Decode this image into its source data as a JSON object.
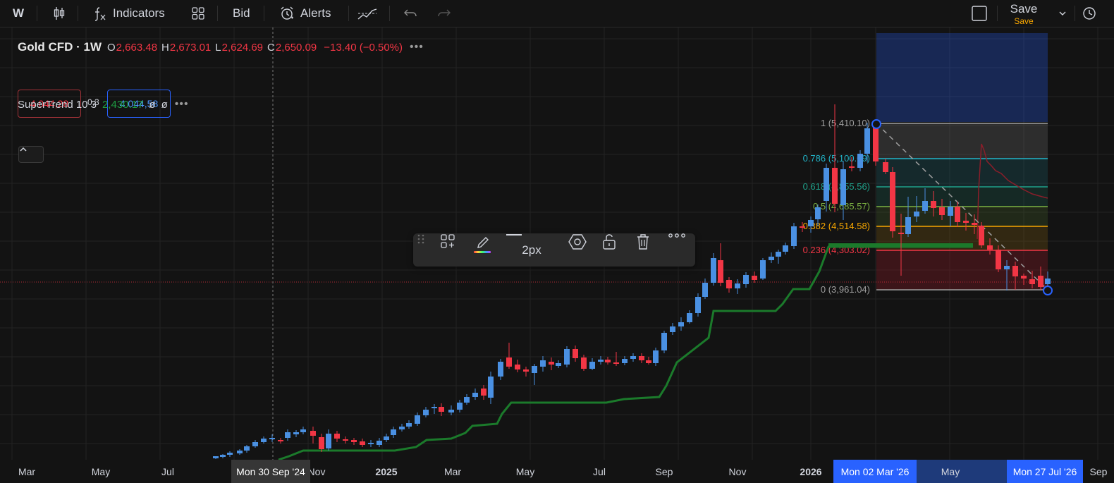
{
  "toolbar": {
    "symbol_short": "W",
    "indicators_label": "Indicators",
    "bid_label": "Bid",
    "alerts_label": "Alerts",
    "save_label": "Save",
    "save_sublabel": "Save",
    "icons": [
      "candles-icon",
      "fx-icon",
      "layout-grid-icon",
      "alert-clock-icon",
      "replay-icon",
      "undo-icon",
      "redo-icon",
      "square-icon",
      "chevron-down-icon",
      "clock-icon"
    ]
  },
  "legend": {
    "symbol": "Gold CFD · 1W",
    "o_key": "O",
    "o_val": "2,663.48",
    "h_key": "H",
    "h_val": "2,673.01",
    "l_key": "L",
    "l_val": "2,624.69",
    "c_key": "C",
    "c_val": "2,650.09",
    "change": "−13.40 (−0.50%)",
    "more": "•••",
    "bid_price": "4 044,28",
    "spread": "0,3",
    "ask_price": "4 044,58",
    "supertrend_name": "SuperTrend 10 3",
    "supertrend_value": "2,430.17",
    "supertrend_na1": "ø",
    "supertrend_na2": "ø",
    "supertrend_more": "•••"
  },
  "drawing_toolbar": {
    "width_label": "2px",
    "icons": [
      "drag-handle-icon",
      "add-to-template-icon",
      "pencil-color-icon",
      "line-style-icon",
      "settings-hexagon-icon",
      "unlock-icon",
      "trash-icon",
      "more-icon"
    ]
  },
  "fib_levels": [
    {
      "label": "1 (5,410.10)",
      "color": "#9e9e9e"
    },
    {
      "label": "0.786 (5,100.09)",
      "color": "#22b4c8"
    },
    {
      "label": "0.618 (4,855.56)",
      "color": "#1fa08a"
    },
    {
      "label": "0.5 (4,685.57)",
      "color": "#7cb342"
    },
    {
      "label": "0.382 (4,514.58)",
      "color": "#f7a600"
    },
    {
      "label": "0.236 (4,303.02)",
      "color": "#f23645"
    },
    {
      "label": "0 (3,961.04)",
      "color": "#9e9e9e"
    }
  ],
  "time_axis": {
    "ticks": [
      "Mar",
      "May",
      "Jul",
      "Nov",
      "2025",
      "Mar",
      "May",
      "Jul",
      "Sep",
      "Nov",
      "2026",
      "May",
      "Sep"
    ],
    "crosshair_label": "Mon 30 Sep '24",
    "range_start_label": "Mon 02 Mar '26",
    "range_end_label": "Mon 27 Jul '26"
  },
  "colors": {
    "up": "#4a90e2",
    "down": "#f23645",
    "supertrend": "#1b7a2b",
    "range_fill": "#2962ff"
  }
}
